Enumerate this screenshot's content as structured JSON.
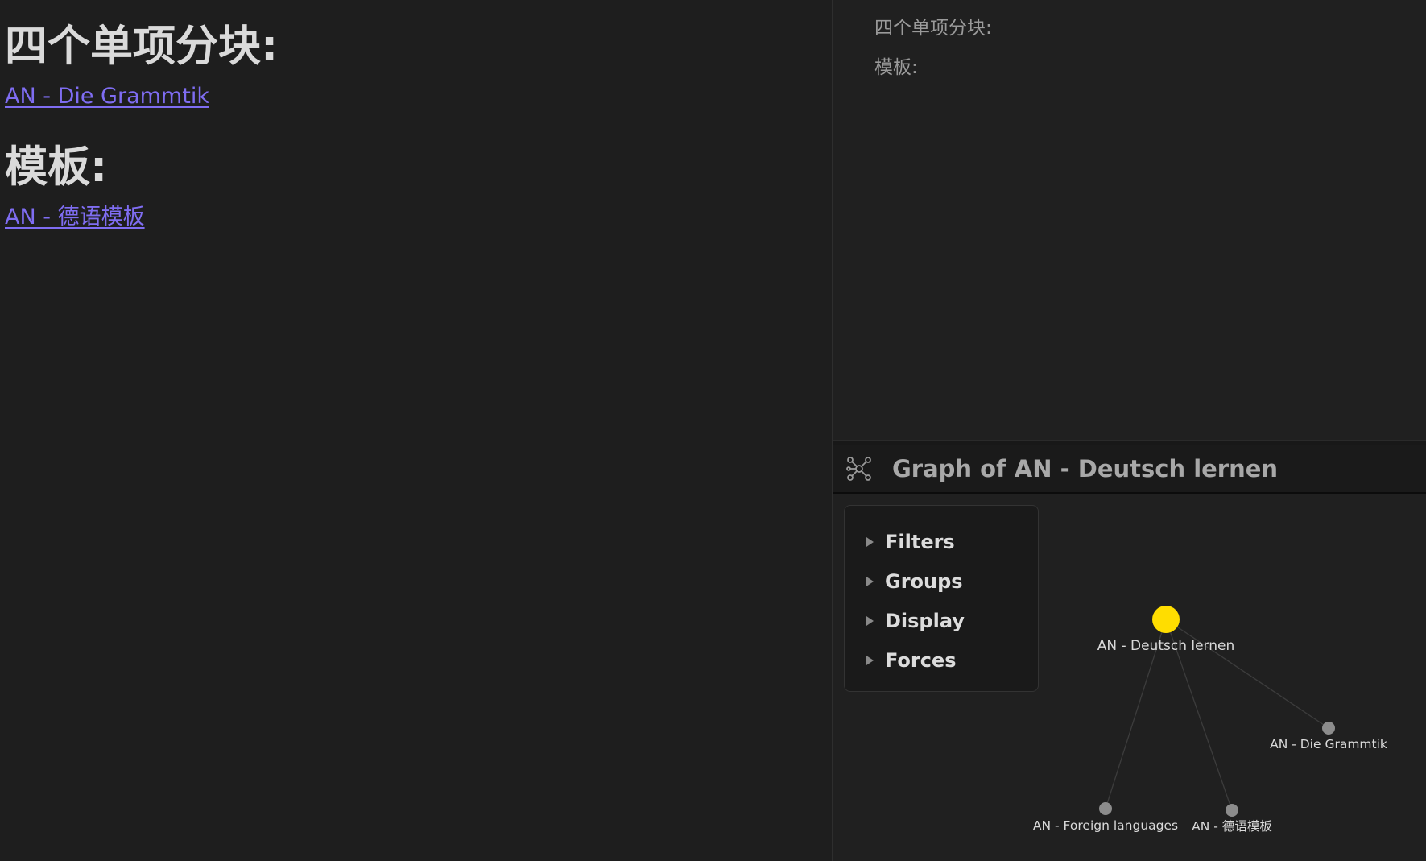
{
  "note": {
    "heading1": "四个单项分块:",
    "link1": "AN - Die Grammtik",
    "heading2": "模板:",
    "link2": "AN - 德语模板"
  },
  "outline": {
    "items": [
      "四个单项分块:",
      "模板:"
    ]
  },
  "graph": {
    "icon": "graph-view-icon",
    "title": "Graph of AN - Deutsch lernen",
    "controls": [
      "Filters",
      "Groups",
      "Display",
      "Forces"
    ],
    "nodes": [
      {
        "id": "center",
        "label": "AN - Deutsch lernen",
        "active": true
      },
      {
        "id": "grammtik",
        "label": "AN - Die Grammtik",
        "active": false
      },
      {
        "id": "foreign",
        "label": "AN - Foreign languages",
        "active": false
      },
      {
        "id": "vorlage",
        "label": "AN - 德语模板",
        "active": false
      }
    ],
    "edges": [
      [
        "center",
        "grammtik"
      ],
      [
        "center",
        "foreign"
      ],
      [
        "center",
        "vorlage"
      ]
    ],
    "colors": {
      "active_node": "#ffdd00",
      "node": "#8c8c8c",
      "edge": "#3c3c3c"
    }
  },
  "colors": {
    "link": "#7f6df2",
    "background": "#1e1e1e"
  }
}
